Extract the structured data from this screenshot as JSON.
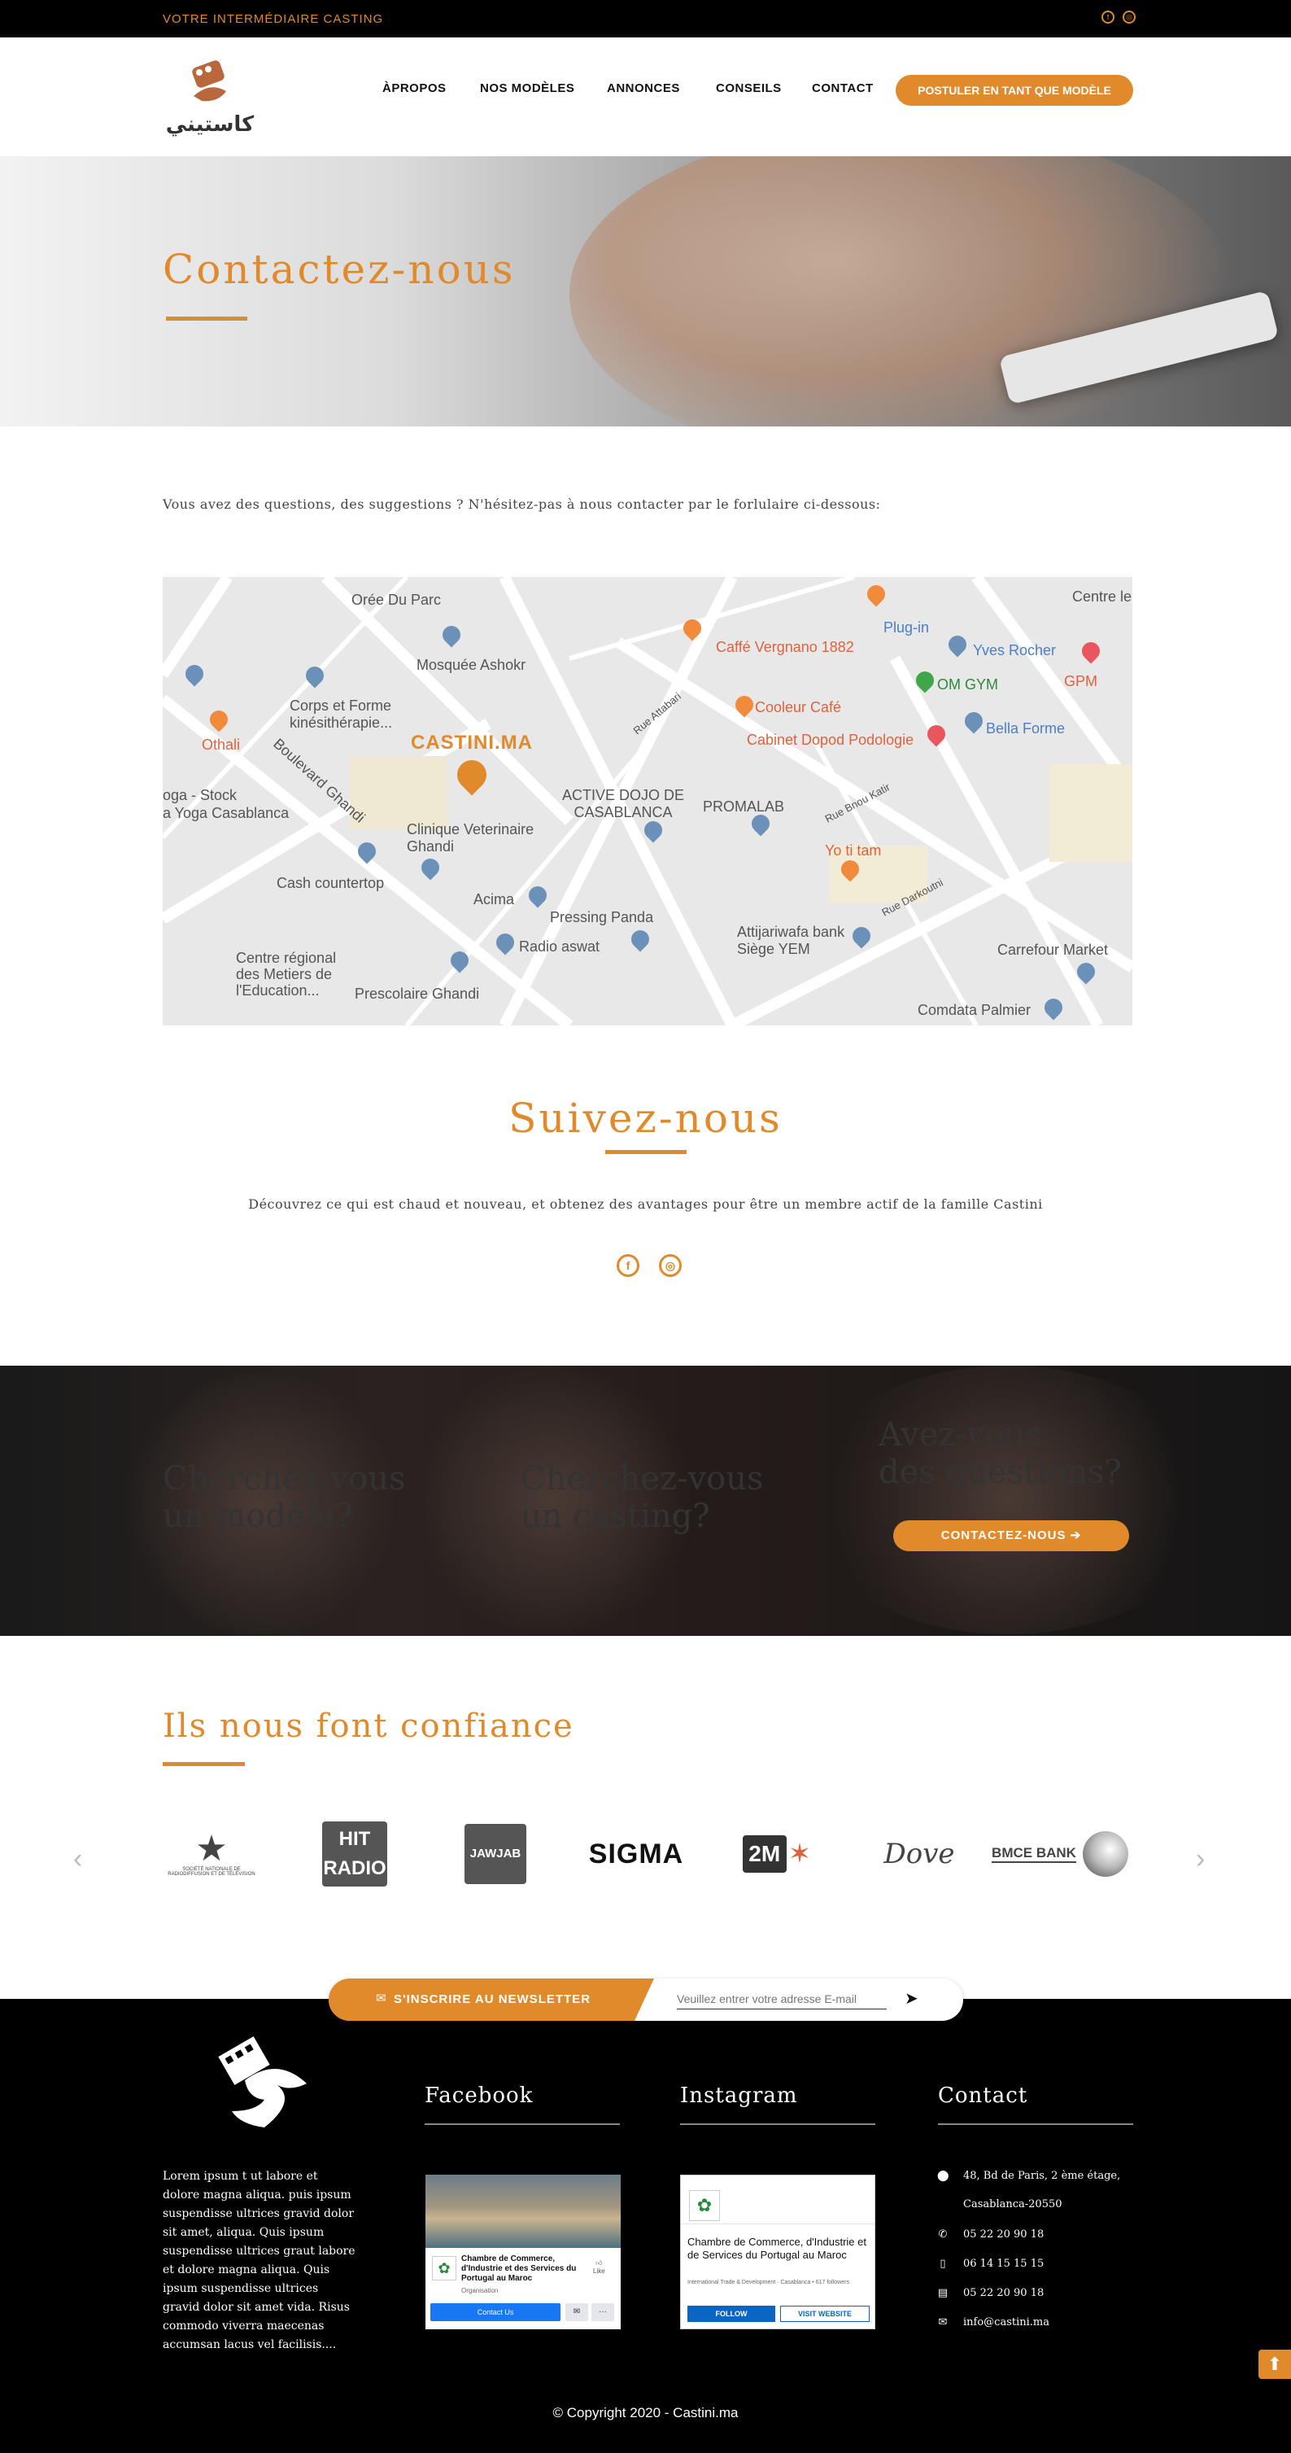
{
  "topbar": {
    "tagline": "VOTRE INTERMÉDIAIRE CASTING",
    "social": [
      {
        "icon": "facebook-icon",
        "glyph": "f"
      },
      {
        "icon": "instagram-icon",
        "glyph": "◎"
      }
    ]
  },
  "header": {
    "logo_text": "كاستيني",
    "nav": [
      "ÀPROPOS",
      "NOS MODÈLES",
      "ANNONCES",
      "CONSEILS",
      "CONTACT"
    ],
    "apply_button": "POSTULER EN TANT QUE MODÈLE"
  },
  "hero": {
    "title": "Contactez-nous"
  },
  "intro": {
    "text": "Vous avez des questions, des suggestions ? N'hésitez-pas à nous contacter par le forlulaire ci-dessous:"
  },
  "map": {
    "marker_label": "CASTINI.MA",
    "labels": [
      "Orée Du Parc",
      "Mosquée Ashokr",
      "Caffé Vergnano 1882",
      "Plug-in",
      "Yves Rocher",
      "Centre le",
      "GPM",
      "OM GYM",
      "Corps et Forme kinésithérapie...",
      "Cooleur Café",
      "Cabinet Dopod Podologie",
      "Bella Forme",
      "Othali",
      "oga - Stock",
      "a Yoga Casablanca",
      "Boulevard Ghandi",
      "ACTIVE DOJO DE CASABLANCA",
      "PROMALAB",
      "Clinique Veterinaire Ghandi",
      "Yo ti tam",
      "Cash countertop",
      "Acima",
      "Pressing Panda",
      "Radio aswat",
      "Attijariwafa bank Siège YEM",
      "Carrefour Market",
      "Centre régional des Metiers de l'Education...",
      "Prescolaire Ghandi",
      "Comdata Palmier",
      "Rue Bnou Katir",
      "Rue Darkoutni",
      "Rue Attabari"
    ]
  },
  "follow": {
    "title": "Suivez-nous",
    "text": "Découvrez ce qui est chaud et nouveau, et obtenez des avantages pour être un membre actif de la famille Castini",
    "icons": [
      {
        "name": "facebook-icon",
        "glyph": "f"
      },
      {
        "name": "instagram-icon",
        "glyph": "◎"
      }
    ]
  },
  "cta": {
    "col1": [
      "Cherchez-vous",
      "un modèle?"
    ],
    "col2": [
      "Cherchez-vous",
      "un casting?"
    ],
    "col3": [
      "Avez-vous",
      "des questions?"
    ],
    "button": "CONTACTEZ-NOUS  ➔"
  },
  "trust": {
    "title": "Ils nous font confiance",
    "logos": [
      {
        "name": "snrt-logo",
        "text": "SOCIÉTÉ NATIONALE DE RADIODIFFUSION ET DE TÉLÉVISION",
        "glyph": "★"
      },
      {
        "name": "hit-radio-logo",
        "text": "HIT RADIO"
      },
      {
        "name": "jawjab-logo",
        "text": "JAWJAB"
      },
      {
        "name": "sigma-logo",
        "text": "SIGMA"
      },
      {
        "name": "2m-logo",
        "text": "2M"
      },
      {
        "name": "dove-logo",
        "text": "Dove"
      },
      {
        "name": "bmce-logo",
        "text": "BMCE BANK"
      }
    ],
    "prev": "‹",
    "next": "›"
  },
  "newsletter": {
    "label": "S'INSCRIRE AU NEWSLETTER",
    "placeholder": "Veuillez entrer votre adresse E-mail",
    "send_glyph": "➤"
  },
  "footer": {
    "about": "Lorem ipsum t ut labore et dolore magna aliqua. puis ipsum suspendisse ultrices gravid dolor sit amet, aliqua. Quis ipsum suspendisse ultrices graut labore et dolore magna aliqua. Quis ipsum suspendisse ultrices gravid dolor sit amet vida. Risus commodo viverra maecenas accumsan lacus vel facilisis....",
    "headings": {
      "facebook": "Facebook",
      "instagram": "Instagram",
      "contact": "Contact"
    },
    "fb_card": {
      "page": "Chambre de Commerce, d'Industrie et des Services du Portugal au Maroc",
      "type": "Organisation",
      "button": "Contact Us",
      "like": "Like"
    },
    "ig_card": {
      "page": "Chambre de Commerce, d'Industrie et de Services du Portugal au Maroc",
      "sub": "International Trade & Development · Casablanca • 617 followers",
      "follow": "FOLLOW",
      "visit": "VISIT WEBSITE"
    },
    "contact": [
      {
        "icon": "location-icon",
        "glyph": "⬤",
        "text": "48, Bd de Paris, 2 ème étage,"
      },
      {
        "icon": "location-icon",
        "glyph": "",
        "text": "Casablanca-20550"
      },
      {
        "icon": "phone-icon",
        "glyph": "✆",
        "text": "05 22 20 90 18"
      },
      {
        "icon": "mobile-icon",
        "glyph": "▯",
        "text": "06 14 15 15 15"
      },
      {
        "icon": "fax-icon",
        "glyph": "▤",
        "text": "05 22 20 90 18"
      },
      {
        "icon": "mail-icon",
        "glyph": "✉",
        "text": "info@castini.ma"
      }
    ],
    "copyright": "© Copyright 2020 - Castini.ma",
    "to_top": "⬆"
  },
  "colors": {
    "accent": "#e08a2c",
    "dark": "#000000"
  }
}
